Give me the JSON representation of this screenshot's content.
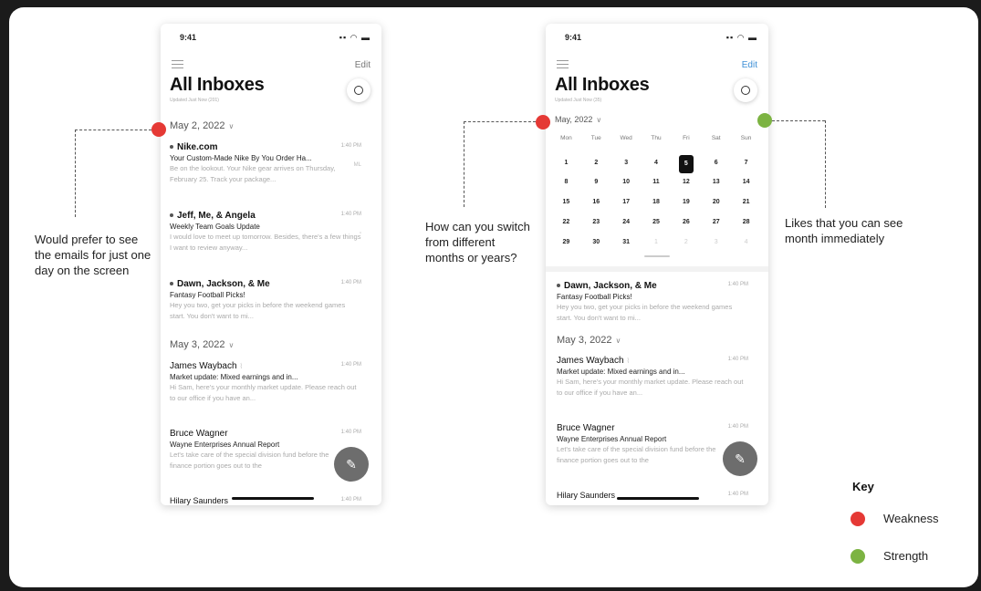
{
  "left_phone": {
    "status_time": "9:41",
    "status_icons": "▪▪ ◠ ▬",
    "edit_label": "Edit",
    "title": "All Inboxes",
    "subtitle": "Updated Just Now (201)",
    "sections": [
      {
        "date": "May 2, 2022",
        "emails": [
          {
            "sender": "Nike.com",
            "time": "1:40 PM",
            "subject": "Your Custom-Made Nike By You Order Ha...",
            "preview": "Be on the lookout. Your Nike gear arrives on Thursday, February 25. Track your package...",
            "tag": "ML"
          },
          {
            "sender": "Jeff, Me, & Angela",
            "time": "1:40 PM",
            "subject": "Weekly Team Goals Update",
            "preview": "I would love to meet up tomorrow. Besides, there's a few things I want to review anyway...",
            "tag": "▫"
          },
          {
            "sender": "Dawn, Jackson, & Me",
            "time": "1:40 PM",
            "subject": "Fantasy Football Picks!",
            "preview": "Hey you two, get your picks in before the weekend games start. You don't want to mi..."
          }
        ]
      },
      {
        "date": "May 3, 2022",
        "emails": [
          {
            "sender": "James Waybach",
            "time": "1:40 PM",
            "subject": "Market update: Mixed earnings and in...",
            "preview": "Hi Sam, here's your monthly market update. Please reach out to our office if you have an..."
          },
          {
            "sender": "Bruce Wagner",
            "time": "1:40 PM",
            "subject": "Wayne Enterprises Annual Report",
            "preview": "Let's take care of the special division fund before the finance portion goes out to the"
          },
          {
            "sender": "Hilary Saunders",
            "time": "1:40 PM"
          }
        ]
      }
    ]
  },
  "right_phone": {
    "status_time": "9:41",
    "status_icons": "▪▪ ◠ ▬",
    "edit_label": "Edit",
    "title": "All Inboxes",
    "subtitle": "Updated Just Now (35)",
    "month_label": "May, 2022",
    "calendar": {
      "weekdays": [
        "Mon",
        "Tue",
        "Wed",
        "Thu",
        "Fri",
        "Sat",
        "Sun"
      ],
      "weeks": [
        [
          "1",
          "2",
          "3",
          "4",
          "5",
          "6",
          "7"
        ],
        [
          "8",
          "9",
          "10",
          "11",
          "12",
          "13",
          "14"
        ],
        [
          "15",
          "16",
          "17",
          "18",
          "19",
          "20",
          "21"
        ],
        [
          "22",
          "23",
          "24",
          "25",
          "26",
          "27",
          "28"
        ],
        [
          "29",
          "30",
          "31",
          "1",
          "2",
          "3",
          "4"
        ]
      ],
      "selected": "5"
    },
    "emails_top": [
      {
        "sender": "Dawn, Jackson, & Me",
        "time": "1:40 PM",
        "subject": "Fantasy Football Picks!",
        "preview": "Hey you two, get your picks in before the weekend games start. You don't want to mi..."
      }
    ],
    "section_date": "May 3, 2022",
    "emails_bottom": [
      {
        "sender": "James Waybach",
        "time": "1:40 PM",
        "subject": "Market update: Mixed earnings and in...",
        "preview": "Hi Sam, here's your monthly market update. Please reach out to our office if you have an..."
      },
      {
        "sender": "Bruce Wagner",
        "time": "1:40 PM",
        "subject": "Wayne Enterprises Annual Report",
        "preview": "Let's take care of the special division fund before the finance portion goes out to the"
      },
      {
        "sender": "Hilary Saunders",
        "time": "1:40 PM"
      }
    ]
  },
  "annotations": {
    "note_left": "Would prefer to see the emails for just one day on the screen",
    "note_middle": "How can you switch from different months or years?",
    "note_right": "Likes that you can see month immediately"
  },
  "key": {
    "title": "Key",
    "weakness": "Weakness",
    "strength": "Strength",
    "weakness_color": "#e53935",
    "strength_color": "#7cb342"
  },
  "icons": {
    "menu": "menu-icon",
    "compose": "pencil-icon",
    "chevron": "chevron-down-icon",
    "attachment": "paperclip-icon"
  }
}
